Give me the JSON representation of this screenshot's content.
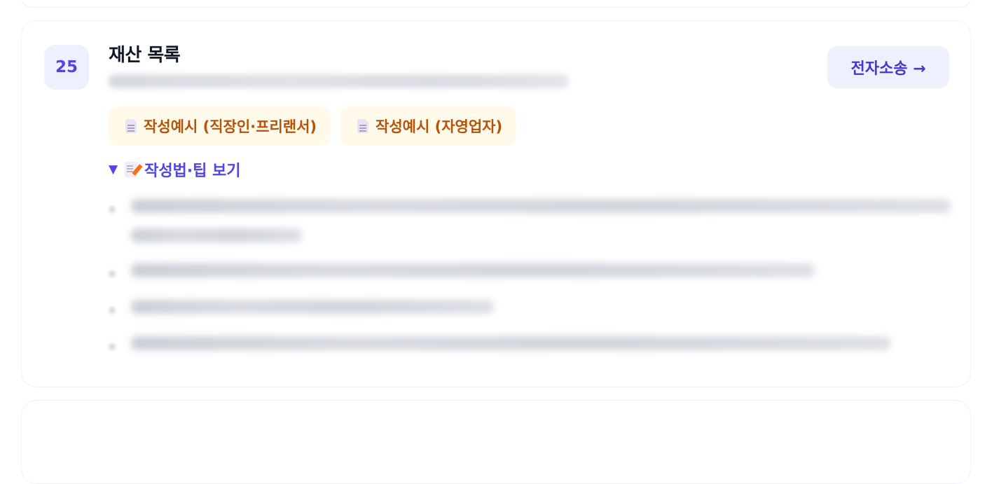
{
  "item": {
    "number": "25",
    "title": "재산 목록",
    "action_label": "전자소송 →"
  },
  "examples": [
    {
      "label": "작성예시 (직장인·프리랜서)",
      "icon": "document-icon"
    },
    {
      "label": "작성예시 (자영업자)",
      "icon": "document-icon"
    }
  ],
  "tips_toggle": {
    "arrow": "▼",
    "icon": "memo-icon",
    "label": "작성법·팁 보기"
  },
  "colors": {
    "accent": "#4f46e5",
    "badge_bg": "#eef1fd",
    "chip_bg": "#fffaea",
    "chip_text": "#b45309"
  }
}
